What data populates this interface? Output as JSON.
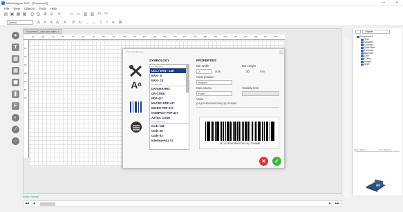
{
  "window": {
    "title": "NiceDesigner 2017 - [Document1]",
    "min": "—",
    "close": "✕"
  },
  "menu": [
    "File",
    "View",
    "Objects",
    "Tools",
    "Help"
  ],
  "toolbar": {
    "zoom_combo": "Default"
  },
  "document_tab": {
    "label": "Document1_Card-size-label.",
    "close": "×"
  },
  "ruler": {
    "h_ticks": [
      "10",
      "20",
      "30",
      "40",
      "50",
      "60",
      "70",
      "80",
      "90",
      "100",
      "110",
      "120",
      "130",
      "140",
      "150",
      "160",
      "170",
      "180",
      "190",
      "200",
      "210",
      "220",
      "230",
      "240",
      "250"
    ],
    "v_ticks": [
      "10",
      "20",
      "30",
      "40",
      "50",
      "60",
      "70"
    ]
  },
  "objects_panel": {
    "tab_label": "Objects",
    "root": "Document1",
    "items": [
      "Text",
      "Variable",
      "Counter",
      "DateTime",
      "Formula",
      "Barcode",
      "Line",
      "Frame",
      "Image",
      "Shift"
    ],
    "zoom_label": "Zoom: 86 %",
    "coords": "X: 0, 20.6 Y%"
  },
  "status": {
    "text": "Active: Normal"
  },
  "dialog": {
    "title": "Properties Barcode",
    "symbology_header": "SYMBOLOGY",
    "properties_header": "PROPERTIES",
    "list": [
      {
        "label": "1D Barcode",
        "kind": "cat"
      },
      {
        "label": "UCC / EAN - 128",
        "kind": "sel"
      },
      {
        "label": "EAN - 8",
        "kind": "item"
      },
      {
        "label": "EAN - 13",
        "kind": "item"
      },
      {
        "label": "2D Barcode",
        "kind": "cat"
      },
      {
        "label": "DATAMATRIX",
        "kind": "item"
      },
      {
        "label": "QR-CODE",
        "kind": "item"
      },
      {
        "label": "PDF-417",
        "kind": "item"
      },
      {
        "label": "MACRO PDF-417",
        "kind": "item"
      },
      {
        "label": "MICRO PDF-417",
        "kind": "item"
      },
      {
        "label": "COMPACT PDF-417",
        "kind": "item"
      },
      {
        "label": "AZTEC CODE",
        "kind": "item"
      },
      {
        "label": "Linear Barcode",
        "kind": "cat"
      },
      {
        "label": "Code 128",
        "kind": "item"
      },
      {
        "label": "Code 39",
        "kind": "item"
      },
      {
        "label": "Code 93",
        "kind": "item"
      },
      {
        "label": "Interleaved 2 / 5",
        "kind": "item"
      }
    ],
    "bar_width_label": "Bar Width",
    "bar_width_value": "2",
    "bar_width_unit": "dots",
    "bar_height_label": "Bar Height",
    "bar_height_value": "20",
    "bar_height_unit": "mm",
    "code_position_label": "Code position",
    "code_position_value": "Bottom",
    "data_source_label": "Data source",
    "data_source_value": "Fixed",
    "variable_field_label": "Variable field",
    "value_label": "Value",
    "value_text": "(01)12345678901234(10)12345BC",
    "barcode_human_text": "(01)12345678901234(10)12345ABC",
    "text_icon_label": "Aᵃ"
  },
  "colors": {
    "selection": "#1d3f7a",
    "cancel": "#e0322f",
    "ok": "#3db53d",
    "tree_icon": "#2f63b8"
  }
}
